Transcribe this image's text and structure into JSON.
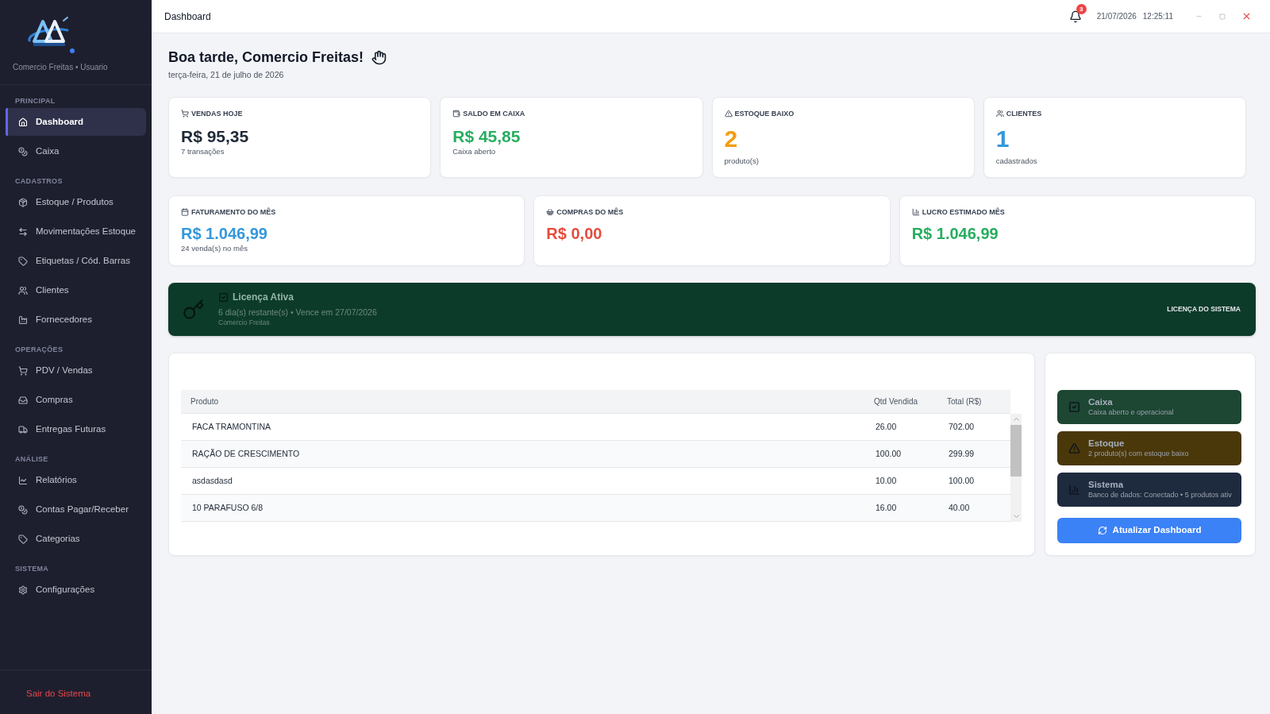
{
  "sidebar": {
    "account": "Comercio Freitas • Usuario",
    "sections": [
      {
        "title": "PRINCIPAL",
        "items": [
          {
            "label": "Dashboard",
            "selected": true
          },
          {
            "label": "Caixa",
            "selected": false
          }
        ]
      },
      {
        "title": "CADASTROS",
        "items": [
          {
            "label": "Estoque / Produtos",
            "selected": false
          },
          {
            "label": "Movimentações Estoque",
            "selected": false
          },
          {
            "label": "Etiquetas / Cód. Barras",
            "selected": false
          },
          {
            "label": "Clientes",
            "selected": false
          },
          {
            "label": "Fornecedores",
            "selected": false
          }
        ]
      },
      {
        "title": "OPERAÇÕES",
        "items": [
          {
            "label": "PDV / Vendas",
            "selected": false
          },
          {
            "label": "Compras",
            "selected": false
          },
          {
            "label": "Entregas Futuras",
            "selected": false
          }
        ]
      },
      {
        "title": "ANÁLISE",
        "items": [
          {
            "label": "Relatórios",
            "selected": false
          },
          {
            "label": "Contas Pagar/Receber",
            "selected": false
          },
          {
            "label": "Categorias",
            "selected": false
          }
        ]
      },
      {
        "title": "SISTEMA",
        "items": [
          {
            "label": "Configurações",
            "selected": false
          }
        ]
      }
    ],
    "logout": "Sair do Sistema"
  },
  "header": {
    "title": "Dashboard",
    "notifications": "3",
    "date": "21/07/2026",
    "time": "12:25:11"
  },
  "greeting": {
    "title": "Boa tarde, Comercio Freitas!",
    "date": "terça-feira, 21 de julho de 2026"
  },
  "summary_cards": [
    {
      "kind": "money",
      "label": "VENDAS HOJE",
      "value": "R$ 95,35",
      "note": "7 transações",
      "color": "#1f2937"
    },
    {
      "kind": "money",
      "label": "SALDO EM CAIXA",
      "value": "R$ 45,85",
      "note": "Caixa aberto",
      "color": "#27ae60"
    },
    {
      "kind": "count",
      "label": "ESTOQUE BAIXO",
      "value": "2",
      "note": "produto(s)",
      "color": "#f39c12"
    },
    {
      "kind": "count",
      "label": "CLIENTES",
      "value": "1",
      "note": "cadastrados",
      "color": "#3498db"
    }
  ],
  "monthly_cards": [
    {
      "label": "FATURAMENTO DO MÊS",
      "value": "R$ 1.046,99",
      "note": "24 venda(s) no mês",
      "color": "#3498db"
    },
    {
      "label": "COMPRAS DO MÊS",
      "value": "R$ 0,00",
      "color": "#e74c3c"
    },
    {
      "label": "LUCRO ESTIMADO MÊS",
      "value": "R$ 1.046,99",
      "color": "#27ae60"
    }
  ],
  "license": {
    "title": "Licença Ativa",
    "details": "6 dia(s) restante(s) • Vence em 27/07/2026",
    "owner": "Comercio Freitas",
    "action": "LICENÇA DO SISTEMA"
  },
  "top_products": {
    "columns": [
      "Produto",
      "Qtd Vendida",
      "Total (R$)"
    ],
    "rows": [
      [
        "FACA TRAMONTINA",
        "26.00",
        "702.00"
      ],
      [
        "RAÇÃO DE CRESCIMENTO",
        "100.00",
        "299.99"
      ],
      [
        "asdasdasd",
        "10.00",
        "100.00"
      ],
      [
        "10 PARAFUSO 6/8",
        "16.00",
        "40.00"
      ]
    ]
  },
  "status": [
    {
      "title": "Caixa",
      "detail": "Caixa aberto e operacional",
      "color": "#1d4633"
    },
    {
      "title": "Estoque",
      "detail": "2 produto(s) com estoque baixo",
      "color": "#4a380b"
    },
    {
      "title": "Sistema",
      "detail": "Banco de dados: Conectado • 5 produtos ativ",
      "color": "#1e2b3e"
    }
  ],
  "refresh_button": "Atualizar Dashboard"
}
